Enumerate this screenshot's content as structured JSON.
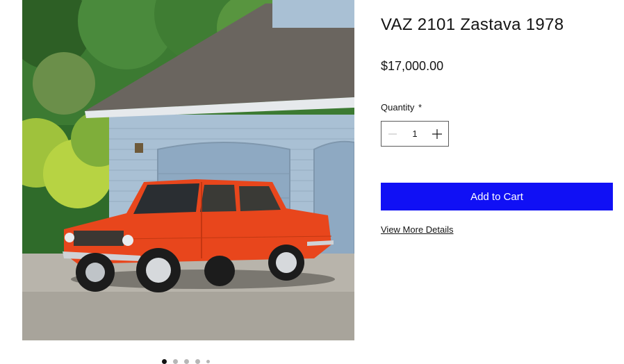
{
  "product": {
    "title": "VAZ 2101 Zastava 1978",
    "price": "$17,000.00",
    "image_icon": "car-photo"
  },
  "quantity": {
    "label": "Quantity",
    "required_marker": "*",
    "value": "1",
    "decrement_icon": "minus-icon",
    "increment_icon": "plus-icon"
  },
  "actions": {
    "add_to_cart": "Add to Cart",
    "view_details": "View More Details"
  },
  "gallery": {
    "dot_count": 5,
    "active_index": 0
  },
  "colors": {
    "accent": "#1010f5",
    "car_body": "#e8461c",
    "garage": "#a9c0d4"
  }
}
